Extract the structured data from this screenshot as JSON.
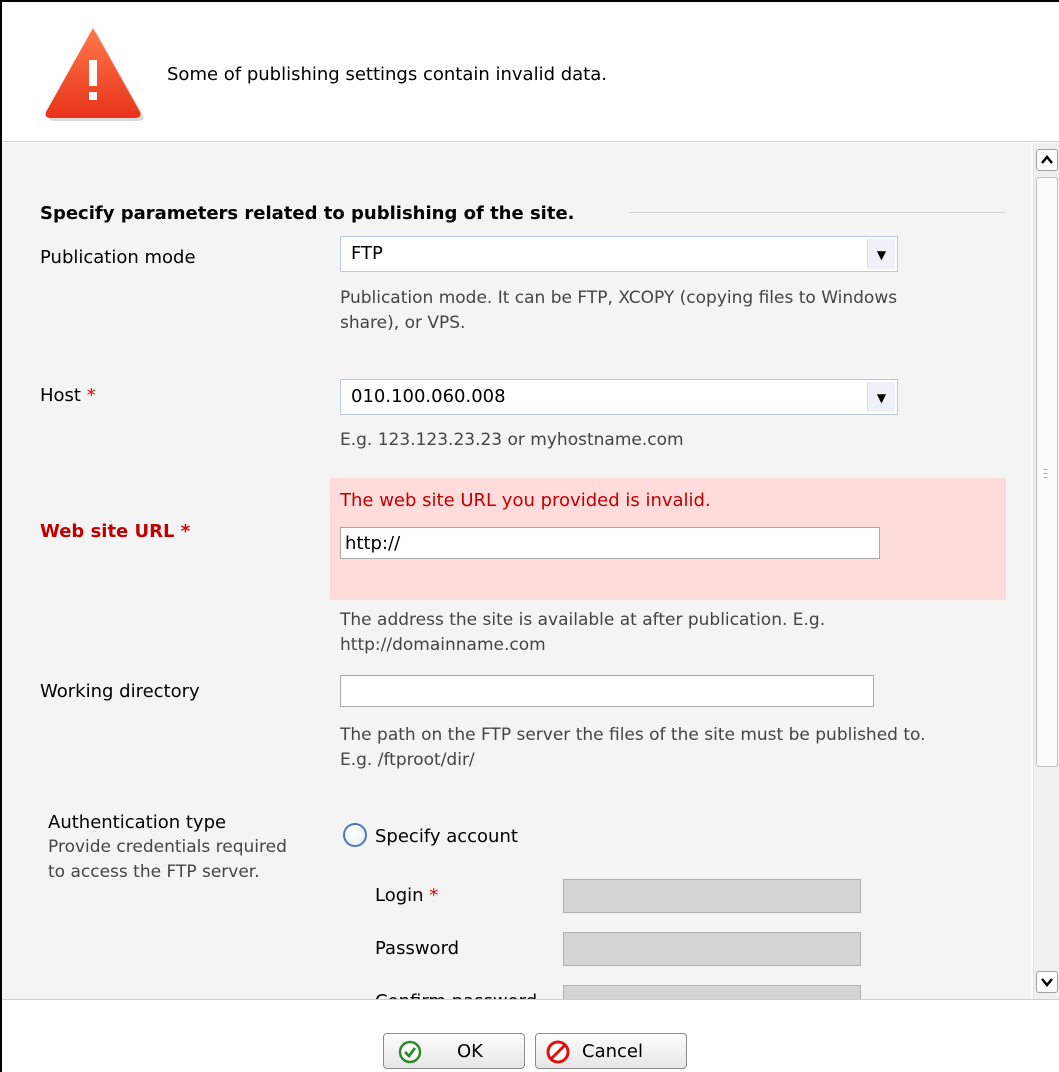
{
  "header": {
    "message": "Some of publishing settings contain invalid data.",
    "icon": "warning-icon"
  },
  "form": {
    "section_title": "Specify parameters related to publishing of the site.",
    "publication_mode": {
      "label": "Publication mode",
      "value": "FTP",
      "hint_line1": "Publication mode. It can be FTP, XCOPY (copying files to Windows",
      "hint_line2": "share), or VPS."
    },
    "host": {
      "label": "Host",
      "required": "*",
      "value": "010.100.060.008",
      "hint": "E.g. 123.123.23.23 or myhostname.com"
    },
    "web_site_url": {
      "label": "Web site URL",
      "required": "*",
      "error": "The web site URL you provided is invalid.",
      "value": "http://",
      "hint_line1": "The address the site is available at after publication. E.g.",
      "hint_line2": "http://domainname.com"
    },
    "working_directory": {
      "label": "Working directory",
      "value": "",
      "hint_line1": "The path on the FTP server the files of the site must be published to.",
      "hint_line2": "E.g. /ftproot/dir/"
    },
    "authentication": {
      "label": "Authentication type",
      "desc_line1": "Provide credentials required",
      "desc_line2": "to access the FTP server.",
      "option_specify": "Specify account",
      "login_label": "Login",
      "login_required": "*",
      "password_label": "Password",
      "confirm_label": "Confirm password"
    }
  },
  "footer": {
    "ok_label": "OK",
    "cancel_label": "Cancel"
  },
  "colors": {
    "error": "#c00000",
    "error_bg": "#ffdcdc",
    "warning": "#f04a23"
  }
}
